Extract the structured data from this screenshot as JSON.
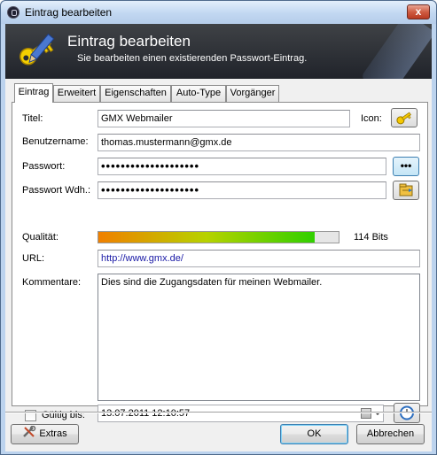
{
  "window": {
    "title": "Eintrag bearbeiten",
    "close_glyph": "x"
  },
  "banner": {
    "title": "Eintrag bearbeiten",
    "subtitle": "Sie bearbeiten einen existierenden Passwort-Eintrag.",
    "icon": "key-pen-icon"
  },
  "tabs": [
    {
      "label": "Eintrag",
      "active": true
    },
    {
      "label": "Erweitert",
      "active": false
    },
    {
      "label": "Eigenschaften",
      "active": false
    },
    {
      "label": "Auto-Type",
      "active": false
    },
    {
      "label": "Vorgänger",
      "active": false
    }
  ],
  "form": {
    "title_label": "Titel:",
    "title_value": "GMX Webmailer",
    "icon_label": "Icon:",
    "username_label": "Benutzername:",
    "username_value": "thomas.mustermann@gmx.de",
    "password_label": "Passwort:",
    "password_value": "••••••••••••••••••••",
    "reveal_glyph": "•••",
    "repeat_label": "Passwort Wdh.:",
    "repeat_value": "••••••••••••••••••••",
    "quality_label": "Qualität:",
    "quality_fraction": 0.9,
    "quality_text": "114 Bits",
    "url_label": "URL:",
    "url_value": "http://www.gmx.de/",
    "notes_label": "Kommentare:",
    "notes_value": "Dies sind die Zugangsdaten für meinen Webmailer.",
    "expires_label": "Gültig bis:",
    "expires_checked": false,
    "expires_value": "13.07.2011 12:10:57"
  },
  "footer": {
    "tools_label": "Extras",
    "ok_label": "OK",
    "cancel_label": "Abbrechen"
  },
  "colors": {
    "banner_dark": "#20232a",
    "url_text": "#1a1aa6",
    "quality_low": "#f08000",
    "quality_high": "#30d000"
  }
}
